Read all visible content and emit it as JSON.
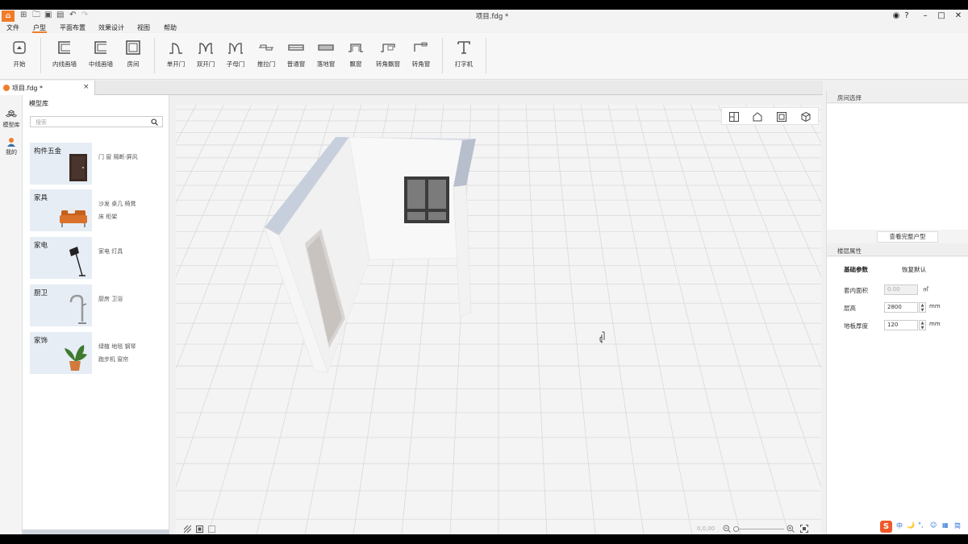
{
  "window": {
    "title": "项目.fdg *",
    "logo_text": "⌂"
  },
  "menu": [
    "文件",
    "户型",
    "平面布置",
    "效果设计",
    "视图",
    "帮助"
  ],
  "ribbon": {
    "items": [
      {
        "label": "开始",
        "icon": "start-icon"
      },
      {
        "label": "内线画墙",
        "icon": "inner-wall-icon"
      },
      {
        "label": "中线画墙",
        "icon": "center-wall-icon"
      },
      {
        "label": "房间",
        "icon": "room-icon"
      },
      {
        "label": "单开门",
        "icon": "single-door-icon"
      },
      {
        "label": "双开门",
        "icon": "double-door-icon"
      },
      {
        "label": "子母门",
        "icon": "mother-son-door-icon"
      },
      {
        "label": "推拉门",
        "icon": "sliding-door-icon"
      },
      {
        "label": "普通窗",
        "icon": "window-icon"
      },
      {
        "label": "落地窗",
        "icon": "floor-window-icon"
      },
      {
        "label": "飘窗",
        "icon": "bay-window-icon"
      },
      {
        "label": "转角飘窗",
        "icon": "corner-bay-window-icon"
      },
      {
        "label": "转角窗",
        "icon": "corner-window-icon"
      },
      {
        "label": "打字机",
        "icon": "text-tool-icon"
      }
    ]
  },
  "doc_tab": {
    "label": "项目.fdg *",
    "close": "×"
  },
  "left_rail": [
    {
      "label": "模型库",
      "icon": "cubes-icon"
    },
    {
      "label": "我的",
      "icon": "user-icon"
    }
  ],
  "library": {
    "title": "模型库",
    "search_placeholder": "搜索",
    "categories": [
      {
        "title": "构件五金",
        "thumb": "door-thumb",
        "sub1": "门  窗  隔断·屏风",
        "sub2": ""
      },
      {
        "title": "家具",
        "thumb": "sofa-thumb",
        "sub1": "沙发  桌几  椅凳",
        "sub2": "床  柜架"
      },
      {
        "title": "家电",
        "thumb": "lamp-thumb",
        "sub1": "家电  灯具",
        "sub2": ""
      },
      {
        "title": "厨卫",
        "thumb": "faucet-thumb",
        "sub1": "厨房  卫浴",
        "sub2": ""
      },
      {
        "title": "家饰",
        "thumb": "plant-thumb",
        "sub1": "绿植  地毯  钢琴",
        "sub2": "跑步机  窗帘"
      }
    ]
  },
  "viewport": {
    "coord": "0,0,00",
    "view_modes": [
      "floorplan-view-icon",
      "house-view-icon",
      "room-view-icon",
      "3d-view-icon"
    ]
  },
  "right_panel": {
    "room_select_title": "房间选择",
    "view_full_button": "查看完整户型",
    "floor_props_title": "楼层属性",
    "tab_basic": "基础参数",
    "tab_restore": "恢复默认",
    "fields": [
      {
        "label": "套内面积",
        "value": "0.00",
        "unit": "㎡",
        "disabled": true
      },
      {
        "label": "层高",
        "value": "2800",
        "unit": "mm",
        "disabled": false
      },
      {
        "label": "地板厚度",
        "value": "120",
        "unit": "mm",
        "disabled": false
      }
    ]
  },
  "ime": {
    "s": "S",
    "items": [
      "中",
      "🌙",
      "°,",
      "☺",
      "▦",
      "简"
    ]
  },
  "colors": {
    "accent": "#f07c2a",
    "card_bg": "#e6edf5"
  }
}
